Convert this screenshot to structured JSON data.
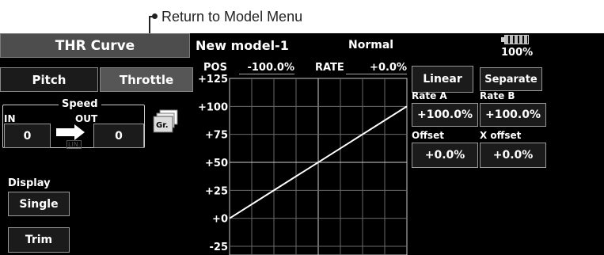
{
  "callout": {
    "text": "Return to Model Menu"
  },
  "header": {
    "screen_title": "THR Curve",
    "model_name": "New model-1",
    "condition": "Normal",
    "battery_percent": "100%"
  },
  "tabs": {
    "pitch": "Pitch",
    "throttle": "Throttle"
  },
  "speed": {
    "title": "Speed",
    "in_label": "IN",
    "out_label": "OUT",
    "in_value": "0",
    "out_value": "0",
    "mode": "LIN.",
    "graph_button": "Gr."
  },
  "display": {
    "label": "Display",
    "single_button": "Single",
    "trim_button": "Trim"
  },
  "readout": {
    "pos_label": "POS",
    "pos_value": "-100.0%",
    "rate_label": "RATE",
    "rate_value": "+0.0%"
  },
  "y_ticks": [
    "+125",
    "+100",
    "+75",
    "+50",
    "+25",
    "+0",
    "-25"
  ],
  "right": {
    "linear_button": "Linear",
    "separate_button": "Separate",
    "rate_a_label": "Rate A",
    "rate_b_label": "Rate B",
    "rate_a_value": "+100.0%",
    "rate_b_value": "+100.0%",
    "offset_label": "Offset",
    "x_offset_label": "X offset",
    "offset_value": "+0.0%",
    "x_offset_value": "+0.0%"
  },
  "chart_data": {
    "type": "line",
    "xlim": [
      -100,
      100
    ],
    "ylim": [
      -25,
      125
    ],
    "x": [
      -100,
      100
    ],
    "y": [
      0,
      100
    ],
    "y_tick_values": [
      125,
      100,
      75,
      50,
      25,
      0,
      -25
    ]
  }
}
